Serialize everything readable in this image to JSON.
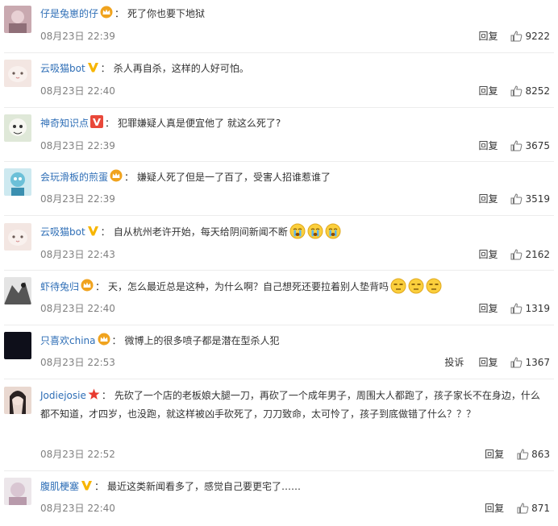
{
  "labels": {
    "reply": "回复",
    "report": "投诉"
  },
  "comments": [
    {
      "username": "仔是兔崽的仔",
      "badge": "crown",
      "text": "死了你也要下地狱",
      "time": "08月23日 22:39",
      "likes": "9222"
    },
    {
      "username": "云吸猫bot",
      "badge": "v-gold",
      "text": "杀人再自杀，这样的人好可怕。",
      "time": "08月23日 22:40",
      "likes": "8252"
    },
    {
      "username": "神奇知识点",
      "badge": "v-red",
      "text": "犯罪嫌疑人真是便宜他了 就这么死了?",
      "time": "08月23日 22:39",
      "likes": "3675"
    },
    {
      "username": "会玩滑板的煎蛋",
      "badge": "crown",
      "text": "嫌疑人死了但是一了百了，受害人招谁惹谁了",
      "time": "08月23日 22:39",
      "likes": "3519"
    },
    {
      "username": "云吸猫bot",
      "badge": "v-gold",
      "text": "自从杭州老许开始，每天给阴间新闻不断",
      "emoji": [
        "crying-emoji",
        "crying-emoji",
        "crying-emoji"
      ],
      "time": "08月23日 22:43",
      "likes": "2162"
    },
    {
      "username": "虾待兔归",
      "badge": "crown",
      "text": "天，怎么最近总是这种，为什么啊？自己想死还要拉着别人垫背吗",
      "emoji": [
        "speechless-emoji",
        "speechless-emoji",
        "speechless-emoji"
      ],
      "time": "08月23日 22:40",
      "likes": "1319"
    },
    {
      "username": "只喜欢china",
      "badge": "crown",
      "text": "微博上的很多喷子都是潜在型杀人犯",
      "time": "08月23日 22:53",
      "likes": "1367",
      "report": true
    },
    {
      "username": "Jodiejosie",
      "badge": "star",
      "text": "先砍了一个店的老板娘大腿一刀，再砍了一个成年男子，周围大人都跑了，孩子家长不在身边，什么都不知道，才四岁，也没跑，就这样被凶手砍死了，刀刀致命，太可怜了，孩子到底做错了什么？？？",
      "time": "08月23日 22:52",
      "likes": "863"
    },
    {
      "username": "腹肌梗塞",
      "badge": "v-gold",
      "text": "最近这类新闻看多了，感觉自己要更宅了……",
      "time": "08月23日 22:40",
      "likes": "871"
    }
  ],
  "colors": {
    "username": "#2e6eb6",
    "time": "#808080",
    "text": "#333333",
    "crown": "#f0a31e",
    "v_gold": "#f7b500",
    "v_red": "#e9483a",
    "star": "#e83a2f"
  }
}
